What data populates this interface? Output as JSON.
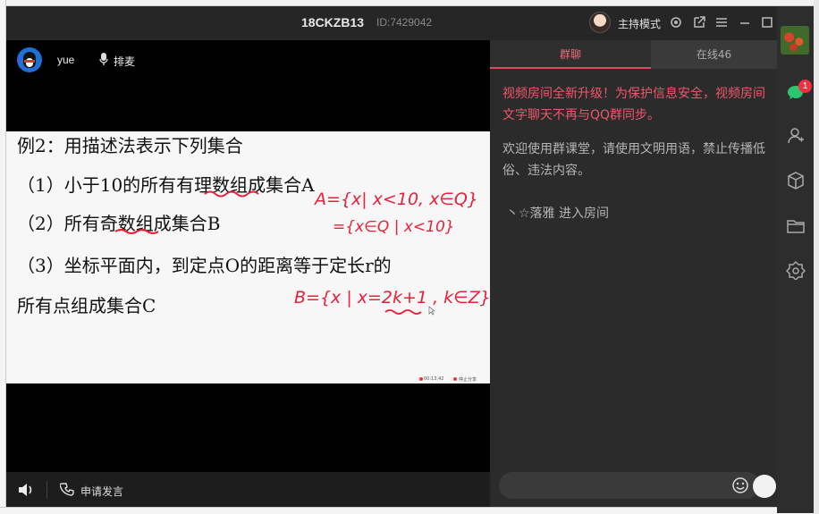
{
  "window": {
    "title": "18CKZB13",
    "room_id": "ID:7429042",
    "host_mode": "主持模式"
  },
  "video": {
    "username": "yue",
    "mic_queue": "排麦",
    "apply_speak": "申请发言"
  },
  "slide": {
    "lines": [
      "例2：用描述法表示下列集合",
      "（1）小于10的所有有理数组成集合A",
      "（2）所有奇数组成集合B",
      "（3）坐标平面内，到定点O的距离等于定长r的",
      "所有点组成集合C"
    ],
    "ink_a1": "A={x| x<10, x∈Q}",
    "ink_a2": "={x∈Q | x<10}",
    "ink_b": "B={x | x=2k+1 , k∈Z}",
    "status_time": "00:13:42",
    "status_share": "停止分享"
  },
  "chat": {
    "tab_group": "群聊",
    "tab_online": "在线46",
    "notice": "视频房间全新升级！为保护信息安全，视频房间文字聊天不再与QQ群同步。",
    "welcome": "欢迎使用群课堂，请使用文明用语，禁止传播低俗、违法内容。",
    "enter_msg": "丶☆落雅 进入房间"
  },
  "rail": {
    "badge_count": "1"
  },
  "colors": {
    "accent": "#e2495c",
    "notice": "#f0566b",
    "ink": "#e8203a"
  }
}
